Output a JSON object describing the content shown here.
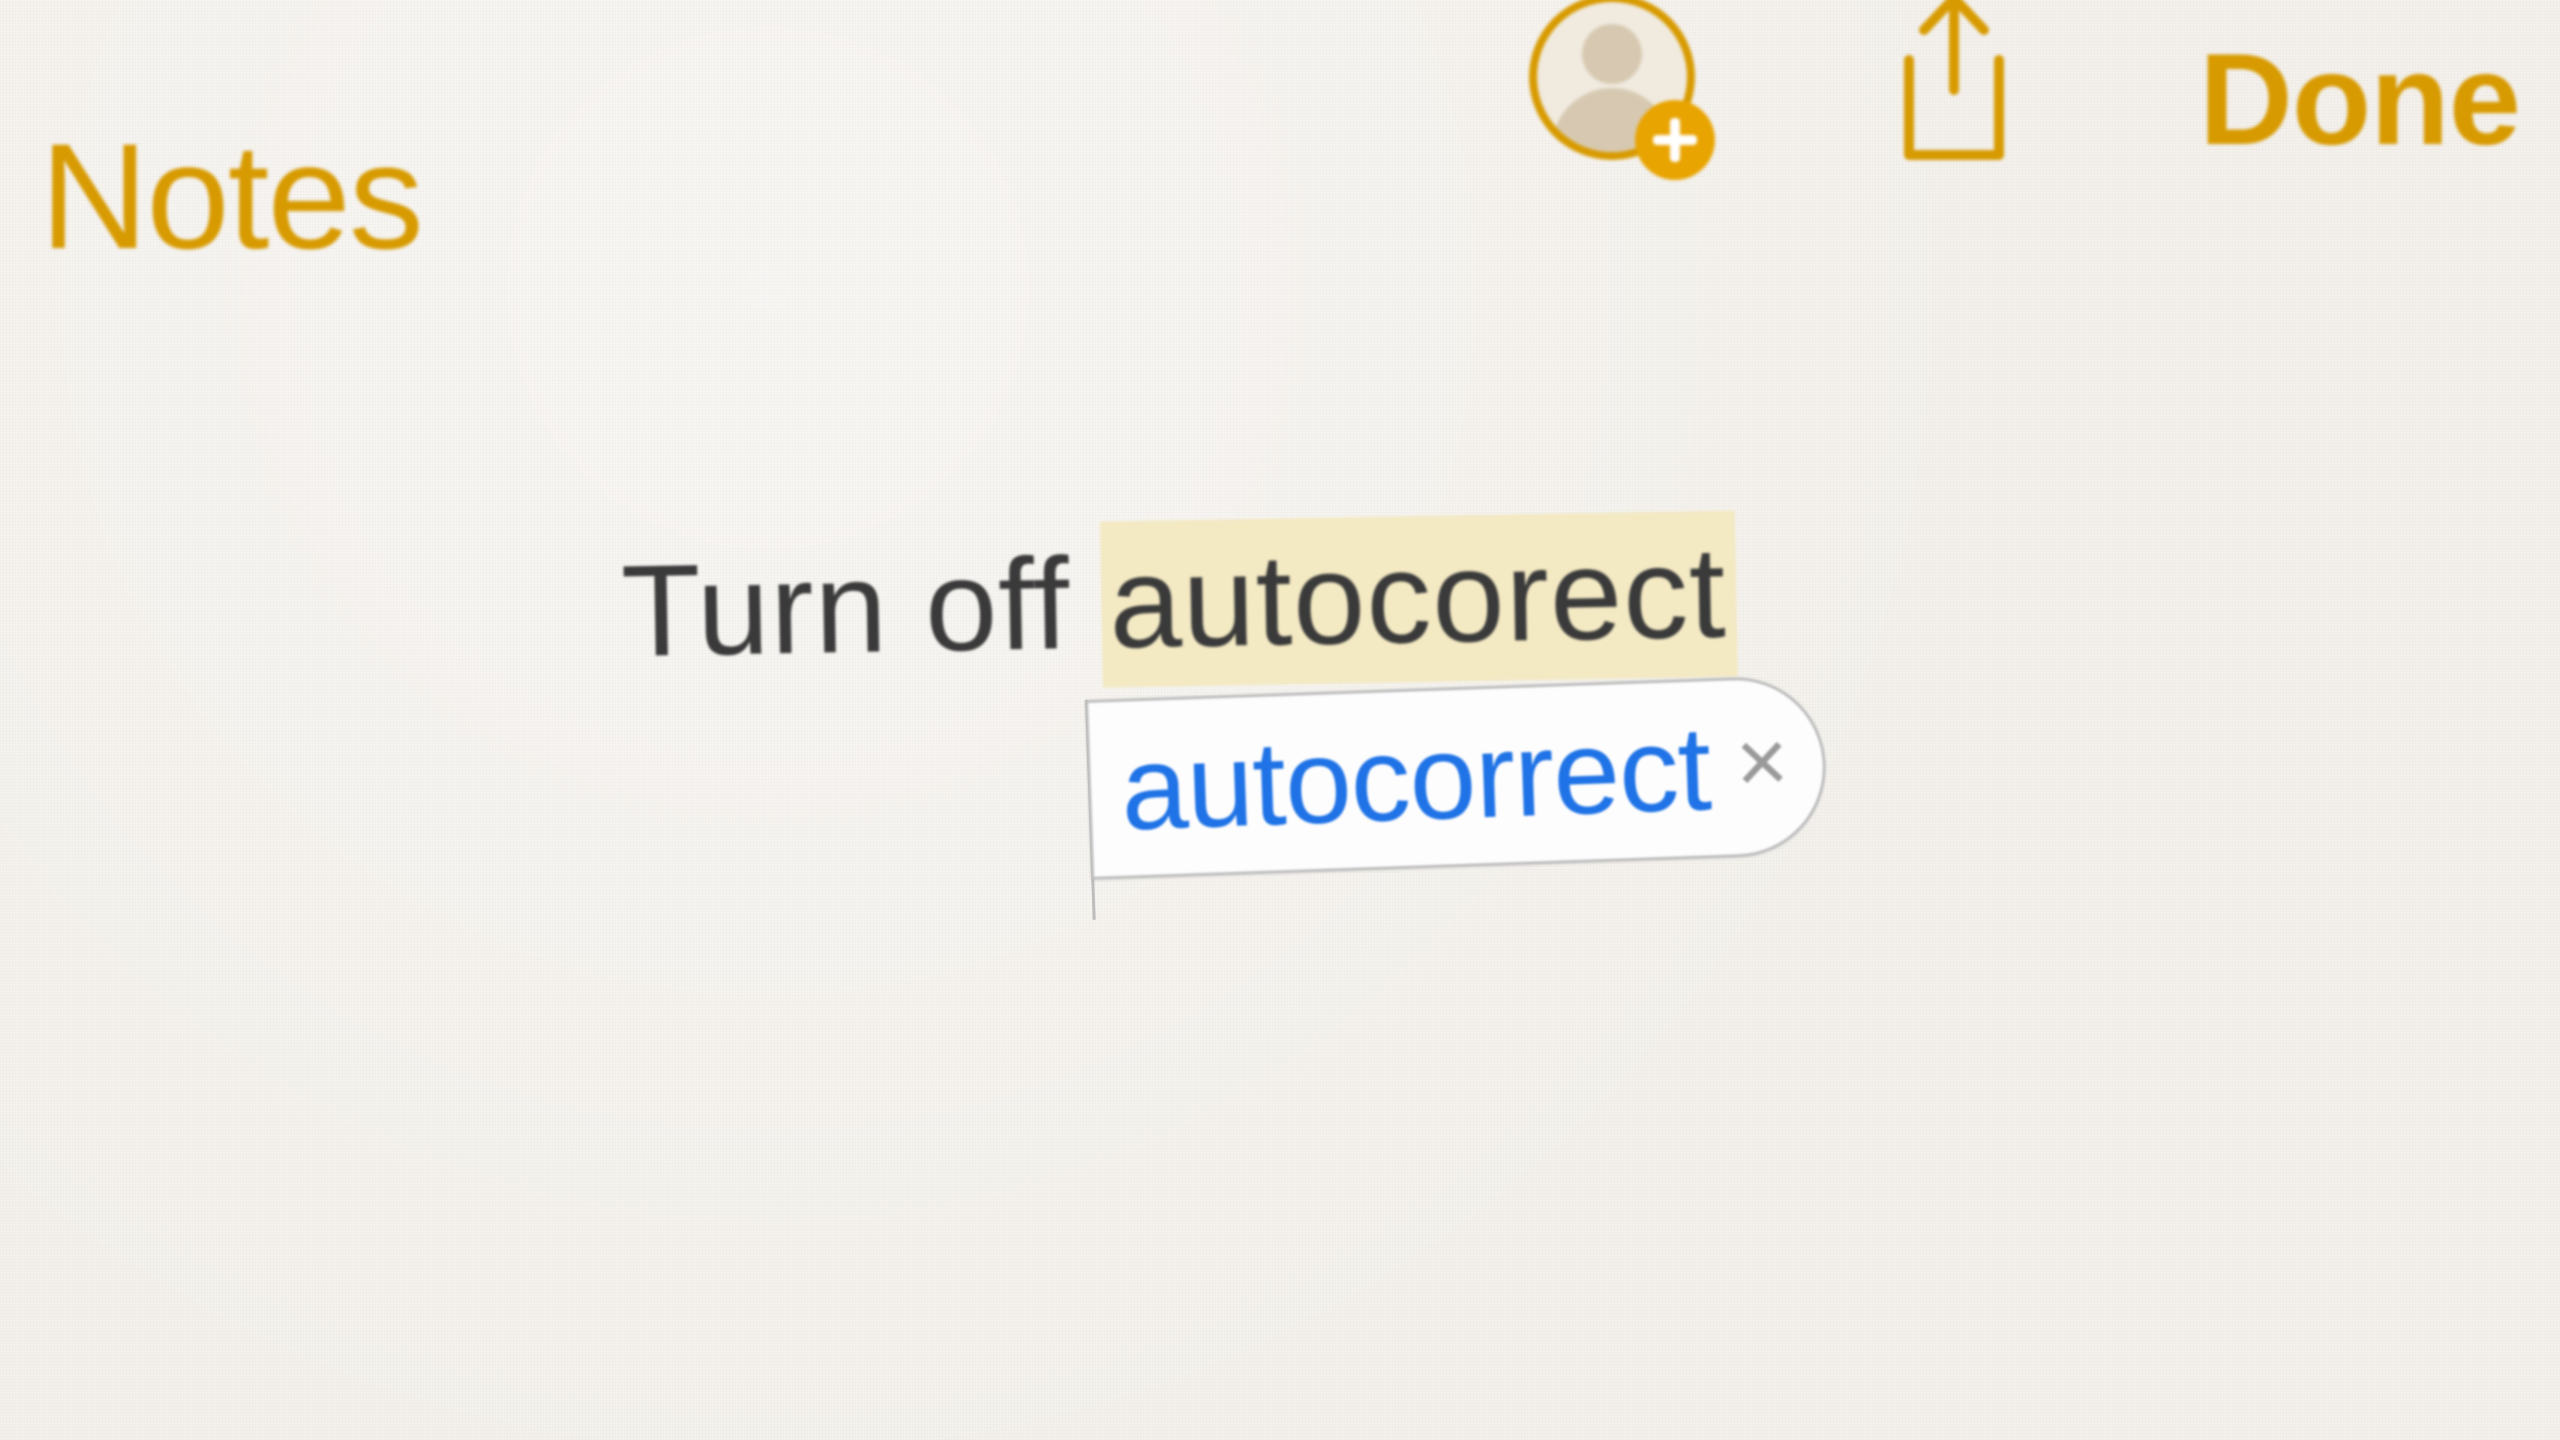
{
  "toolbar": {
    "back_label": "Notes",
    "done_label": "Done"
  },
  "note": {
    "text_prefix": "Turn off ",
    "misspelled_word": "autocorect"
  },
  "autocorrect": {
    "suggestion": "autocorrect",
    "dismiss_glyph": "×"
  },
  "colors": {
    "accent": "#d79a00",
    "suggestion_text": "#1f73e6",
    "highlight": "#f3e9c3"
  }
}
